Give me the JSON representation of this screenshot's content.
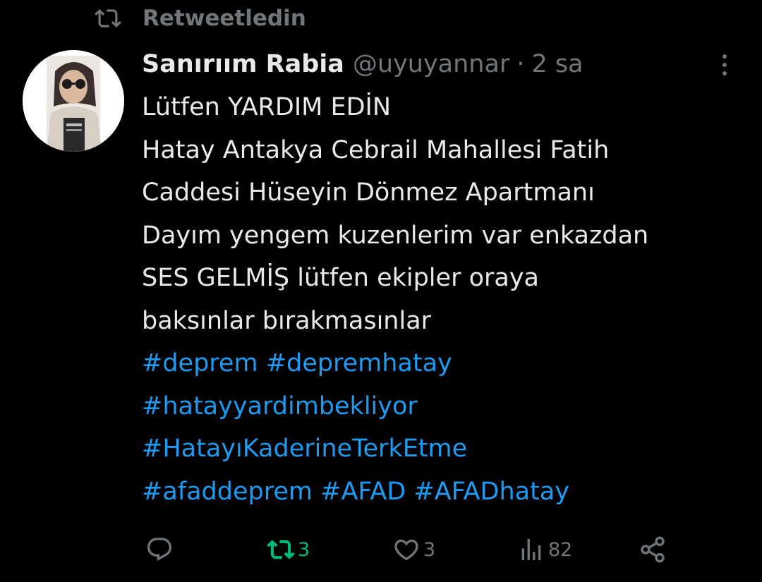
{
  "retweet_banner": {
    "icon": "retweet-icon",
    "label": "Retweetledin"
  },
  "tweet": {
    "author": {
      "display_name": "Sanırıım Rabia",
      "handle": "@uyuyannar",
      "separator": "·",
      "time": "2 sa",
      "avatar": "avatar"
    },
    "text_lines": [
      "Lütfen YARDIM EDİN",
      "Hatay Antakya Cebrail Mahallesi Fatih",
      "Caddesi Hüseyin Dönmez Apartmanı",
      "Dayım yengem kuzenlerim var enkazdan",
      "SES GELMİŞ lütfen ekipler oraya",
      "baksınlar bırakmasınlar"
    ],
    "hashtag_lines": [
      [
        "#deprem",
        "#depremhatay"
      ],
      [
        "#hatayyardimbekliyor"
      ],
      [
        "#HatayıKaderineTerkEtme"
      ],
      [
        "#afaddeprem",
        "#AFAD",
        "#AFADhatay"
      ]
    ],
    "actions": {
      "reply": {
        "icon": "reply-icon",
        "count": ""
      },
      "retweet": {
        "icon": "retweet-icon",
        "count": "3",
        "active": true
      },
      "like": {
        "icon": "heart-icon",
        "count": "3"
      },
      "views": {
        "icon": "views-icon",
        "count": "82"
      },
      "share": {
        "icon": "share-icon"
      }
    }
  },
  "colors": {
    "background": "#000000",
    "text": "#e7e9ea",
    "muted": "#71767b",
    "link": "#1d9bf0",
    "retweet_active": "#00ba7c"
  }
}
